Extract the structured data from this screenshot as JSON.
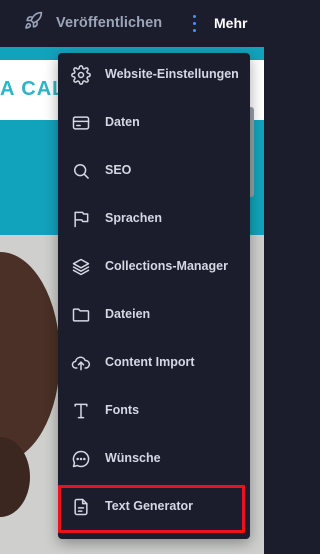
{
  "topbar": {
    "publish_label": "Veröffentlichen",
    "more_label": "Mehr"
  },
  "background": {
    "band_text": "A CAL"
  },
  "menu": {
    "items": [
      {
        "label": "Website-Einstellungen",
        "icon": "gear-icon"
      },
      {
        "label": "Daten",
        "icon": "card-icon"
      },
      {
        "label": "SEO",
        "icon": "search-icon"
      },
      {
        "label": "Sprachen",
        "icon": "flag-icon"
      },
      {
        "label": "Collections-Manager",
        "icon": "layers-icon"
      },
      {
        "label": "Dateien",
        "icon": "folder-icon"
      },
      {
        "label": "Content Import",
        "icon": "cloud-upload-icon"
      },
      {
        "label": "Fonts",
        "icon": "text-t-icon"
      },
      {
        "label": "Wünsche",
        "icon": "chat-bubble-icon"
      },
      {
        "label": "Text Generator",
        "icon": "document-icon"
      }
    ],
    "highlighted_item": "Text Generator"
  },
  "colors": {
    "bar_bg": "#1b1c2c",
    "accent": "#4d8fff",
    "highlight": "#e8131b",
    "page_bg": "#12a3bc"
  }
}
